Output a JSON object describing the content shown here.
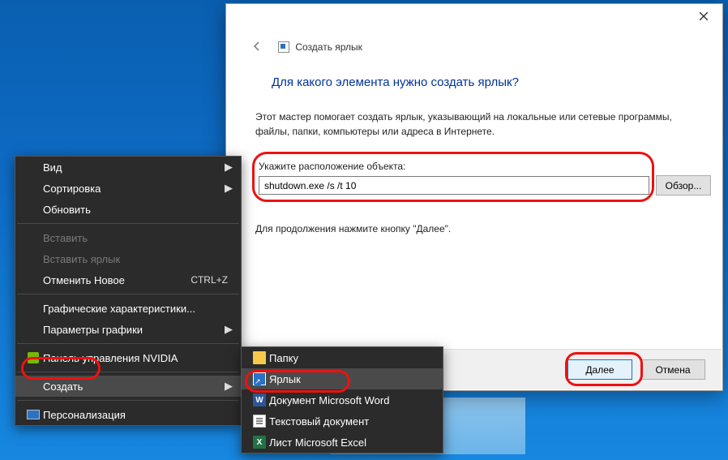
{
  "wizard": {
    "title_small": "Создать ярлык",
    "heading": "Для какого элемента нужно создать ярлык?",
    "description": "Этот мастер помогает создать ярлык, указывающий на локальные или сетевые программы, файлы, папки, компьютеры или адреса в Интернете.",
    "field_label": "Укажите расположение объекта:",
    "input_value": "shutdown.exe /s /t 10",
    "browse_label": "Обзор...",
    "continue_text": "Для продолжения нажмите кнопку \"Далее\".",
    "next_label": "Далее",
    "cancel_label": "Отмена"
  },
  "context_menu": {
    "items": [
      {
        "label": "Вид",
        "has_submenu": true
      },
      {
        "label": "Сортировка",
        "has_submenu": true
      },
      {
        "label": "Обновить"
      },
      {
        "sep": true
      },
      {
        "label": "Вставить",
        "disabled": true
      },
      {
        "label": "Вставить ярлык",
        "disabled": true
      },
      {
        "label": "Отменить Новое",
        "shortcut": "CTRL+Z"
      },
      {
        "sep": true
      },
      {
        "label": "Графические характеристики..."
      },
      {
        "label": "Параметры графики",
        "has_submenu": true
      },
      {
        "sep": true
      },
      {
        "label": "Панель управления NVIDIA",
        "icon": "nvidia-icon"
      },
      {
        "sep": true
      },
      {
        "label": "Создать",
        "has_submenu": true,
        "highlight": true
      },
      {
        "sep": true
      },
      {
        "label": "Персонализация",
        "icon": "display-icon"
      }
    ],
    "submenu": [
      {
        "label": "Папку",
        "icon": "folder-icon"
      },
      {
        "label": "Ярлык",
        "icon": "shortcut-icon",
        "highlight": true
      },
      {
        "label": "Документ Microsoft Word",
        "icon": "word-icon"
      },
      {
        "label": "Текстовый документ",
        "icon": "text-icon"
      },
      {
        "label": "Лист Microsoft Excel",
        "icon": "excel-icon"
      }
    ]
  }
}
